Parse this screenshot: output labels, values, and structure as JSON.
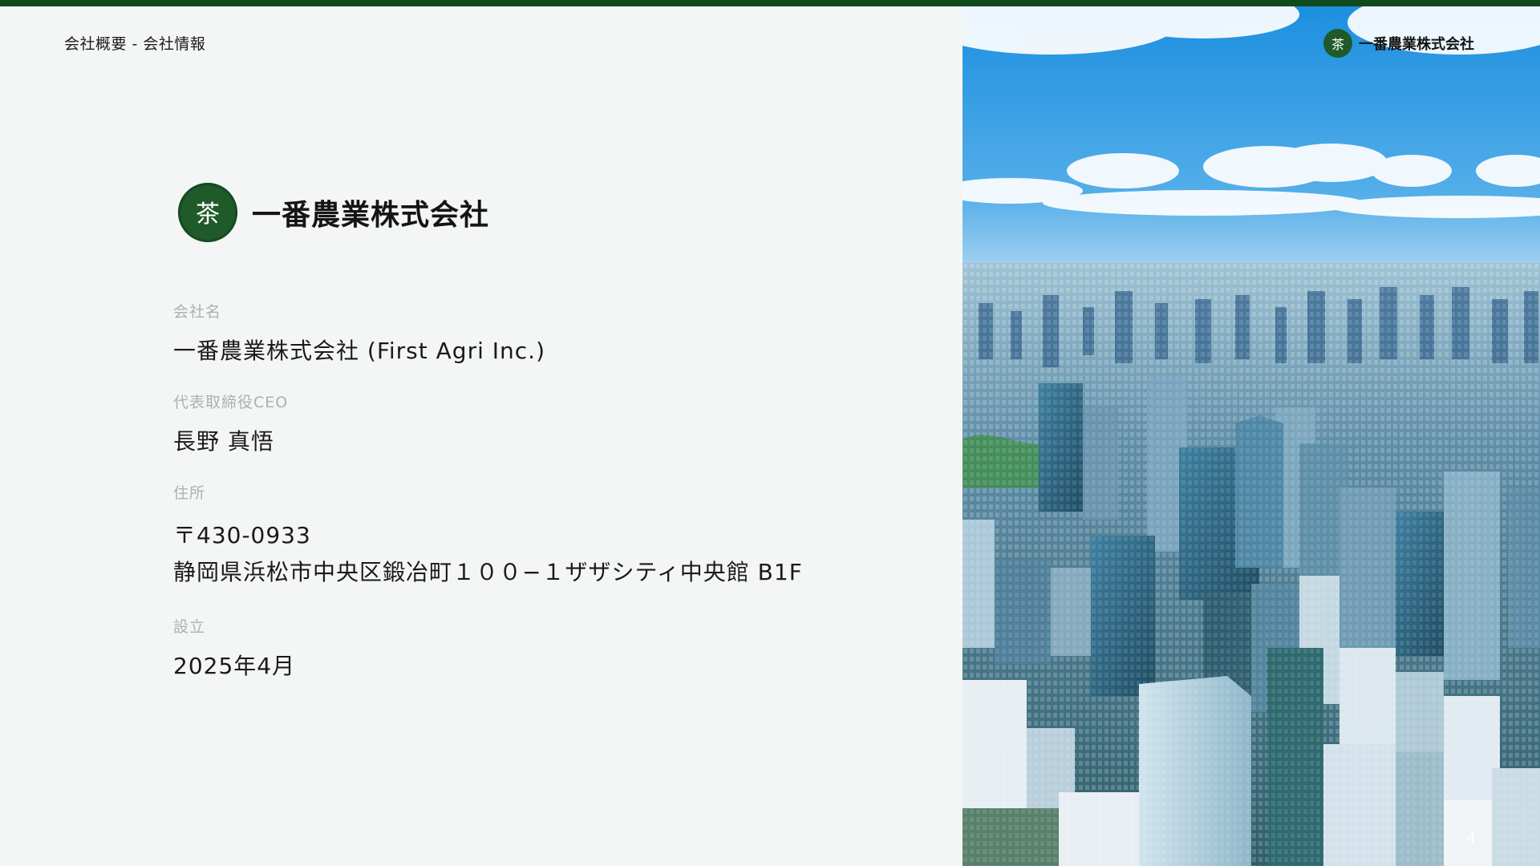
{
  "header": {
    "breadcrumb": "会社概要 - 会社情報"
  },
  "brand": {
    "seal_glyph": "茶",
    "wordmark": "一番農業株式会社",
    "color": "#1f5a2a"
  },
  "fields": [
    {
      "label": "会社名",
      "lines": [
        "一番農業株式会社 (First Agri Inc.)"
      ]
    },
    {
      "label": "代表取締役CEO",
      "lines": [
        "長野 真悟"
      ]
    },
    {
      "label": "住所",
      "lines": [
        "〒430-0933",
        "静岡県浜松市中央区鍛冶町１００−１ザザシティ中央館 B1F"
      ]
    },
    {
      "label": "設立",
      "lines": [
        "2025年4月"
      ]
    }
  ],
  "footer": {
    "page_number": "4"
  },
  "colors": {
    "top_bar": "#0f4a1f",
    "background": "#f3f6f4",
    "label": "#a8b5ab"
  }
}
